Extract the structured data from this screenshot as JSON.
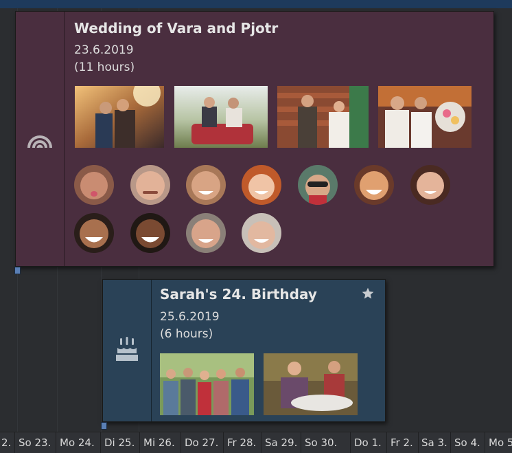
{
  "colors": {
    "wedding_bg": "#4a2e3f",
    "birthday_bg": "#2a4257",
    "timeline_bg": "#303236",
    "top_bar": "#1e3a5c"
  },
  "wedding": {
    "title": "Wedding of Vara and Pjotr",
    "date": "23.6.2019",
    "duration": "(11 hours)",
    "icon": "rainbow-icon"
  },
  "birthday": {
    "title": "Sarah's 24. Birthday",
    "date": "25.6.2019",
    "duration": "(6 hours)",
    "icon": "birthday-cake-icon",
    "favorite_icon": "star-icon"
  },
  "timeline": {
    "days": [
      "2.",
      "So 23.",
      "Mo 24.",
      "Di 25.",
      "Mi 26.",
      "Do 27.",
      "Fr 28.",
      "Sa 29.",
      "So 30.",
      "Do 1.",
      "Fr 2.",
      "Sa 3.",
      "So 4.",
      "Mo 5"
    ]
  }
}
